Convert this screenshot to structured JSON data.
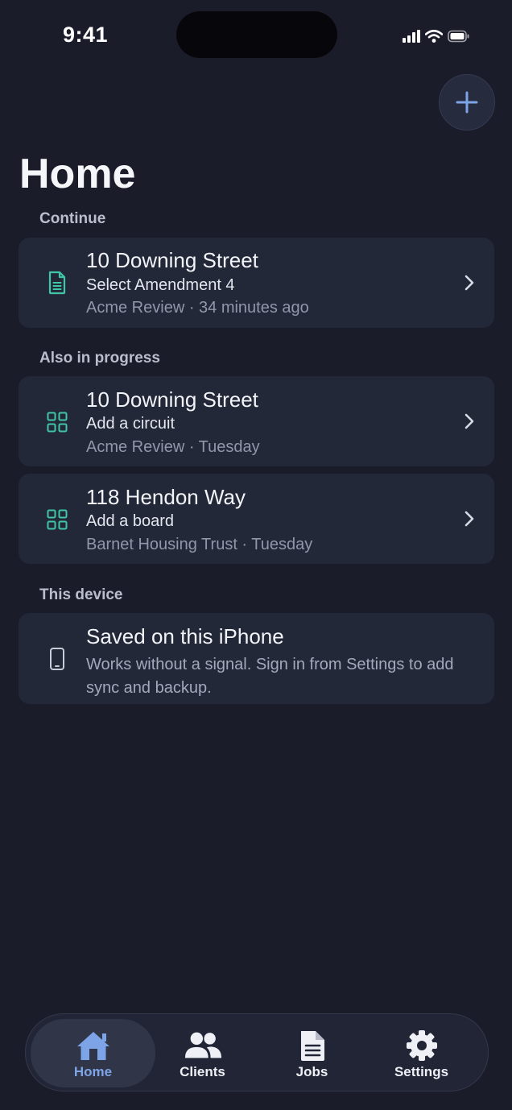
{
  "status_bar": {
    "time": "9:41"
  },
  "header": {
    "title": "Home"
  },
  "sections": {
    "continue": "Continue",
    "in_progress": "Also in progress",
    "device": "This device"
  },
  "continue_card": {
    "title": "10 Downing Street",
    "subtitle": "Select Amendment 4",
    "meta": "Acme Review · 34 minutes ago",
    "icon": "document-icon"
  },
  "in_progress": [
    {
      "title": "10 Downing Street",
      "subtitle": "Add a circuit",
      "meta": "Acme Review · Tuesday",
      "icon": "grid-icon"
    },
    {
      "title": "118 Hendon Way",
      "subtitle": "Add a board",
      "meta": "Barnet Housing Trust · Tuesday",
      "icon": "grid-icon"
    }
  ],
  "device_card": {
    "title": "Saved on this iPhone",
    "description": "Works without a signal. Sign in from Settings to add sync and backup.",
    "icon": "phone-icon"
  },
  "tabs": [
    {
      "label": "Home",
      "icon": "home-icon",
      "active": true
    },
    {
      "label": "Clients",
      "icon": "people-icon",
      "active": false
    },
    {
      "label": "Jobs",
      "icon": "file-icon",
      "active": false
    },
    {
      "label": "Settings",
      "icon": "gear-icon",
      "active": false
    }
  ],
  "colors": {
    "background": "#1b1c2a",
    "card": "#232839",
    "accent_teal": "#3fc6a6",
    "accent_blue": "#7ea4e8"
  }
}
